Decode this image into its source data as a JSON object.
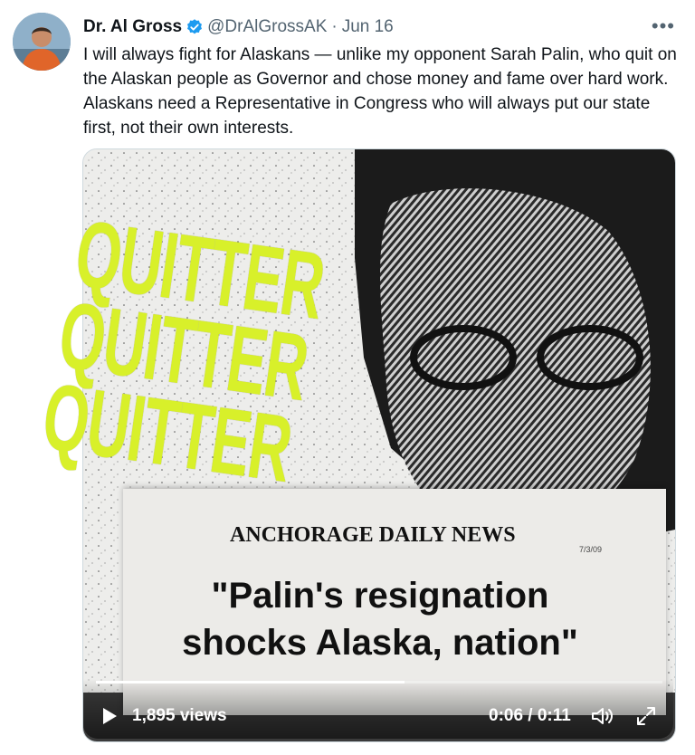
{
  "author": {
    "name": "Dr. Al Gross",
    "handle": "@DrAlGrossAK",
    "separator": "·",
    "date": "Jun 16",
    "verified_icon": "verified-badge-icon",
    "verified_color": "#1d9bf0"
  },
  "more_label": "•••",
  "tweet_text": "I will always fight for Alaskans — unlike my opponent Sarah Palin, who quit on the Alaskan people as Governor and chose money and fame over hard work. Alaskans need a Representative in Congress who will always put our state first, not their own interests.",
  "media": {
    "overlay_words": [
      "QUITTER",
      "QUITTER",
      "QUITTER"
    ],
    "overlay_color": "#d8f02a",
    "newspaper": {
      "masthead": "ANCHORAGE DAILY NEWS",
      "date": "7/3/09",
      "headline_line1": "\"Palin's resignation",
      "headline_line2": "shocks Alaska, nation\""
    },
    "video": {
      "views": "1,895 views",
      "time": "0:06 / 0:11",
      "progress_fraction": 0.545,
      "play_icon": "play-icon",
      "volume_icon": "volume-icon",
      "fullscreen_icon": "fullscreen-icon"
    }
  }
}
